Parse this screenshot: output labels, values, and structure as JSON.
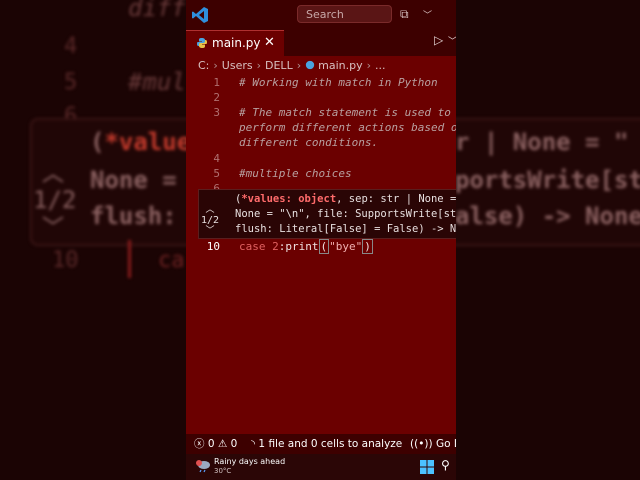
{
  "background": {
    "top_text": "diff",
    "line_numbers": [
      "4",
      "5",
      "6",
      "10"
    ],
    "comment": "#mul",
    "hover_count": "1/2",
    "hover_lines": [
      {
        "prefix": "(",
        "kw": "*value",
        "rest": "",
        "tail": "r | None = \""
      },
      {
        "prefix": "None = ",
        "kw": "",
        "rest": "",
        "tail": "portsWrite[str]"
      },
      {
        "prefix": "flush: ",
        "kw": "",
        "rest": "",
        "tail": "alse) -> None"
      }
    ],
    "case_text": "ca"
  },
  "titlebar": {
    "search_placeholder": "Search"
  },
  "tab": {
    "label": "main.py",
    "close": "✕"
  },
  "breadcrumb": {
    "parts": [
      "C:",
      "Users",
      "DELL",
      "main.py",
      "..."
    ]
  },
  "editor": {
    "lines": [
      {
        "num": "1",
        "text": "# Working with match in Python"
      },
      {
        "num": "2",
        "text": ""
      },
      {
        "num": "3",
        "text": "# The match statement is used to"
      },
      {
        "num": "",
        "text": "perform different actions based on"
      },
      {
        "num": "",
        "text": "different conditions."
      },
      {
        "num": "4",
        "text": ""
      },
      {
        "num": "5",
        "text": "#multiple choices"
      },
      {
        "num": "6",
        "text": ""
      }
    ],
    "current_line": {
      "num": "10",
      "case_kw": "case",
      "number": "2",
      "before": ":print",
      "open_paren": "(",
      "string": "\"bye\"",
      "close_paren": ")"
    }
  },
  "hover": {
    "count": "1/2",
    "line1_prefix": "(",
    "line1_kw": "*values: object",
    "line1_rest": ", sep: str | None = \"",
    "line2": "None = \"\\n\", file: SupportsWrite[str]",
    "line3": "flush: Literal[False] = False) -> None"
  },
  "statusbar": {
    "errors": "0",
    "warnings": "0",
    "analysis": "1 file and 0 cells to analyze",
    "golive": "Go Live"
  },
  "taskbar": {
    "weather_title": "Rainy days ahead",
    "weather_temp": "30°C"
  }
}
